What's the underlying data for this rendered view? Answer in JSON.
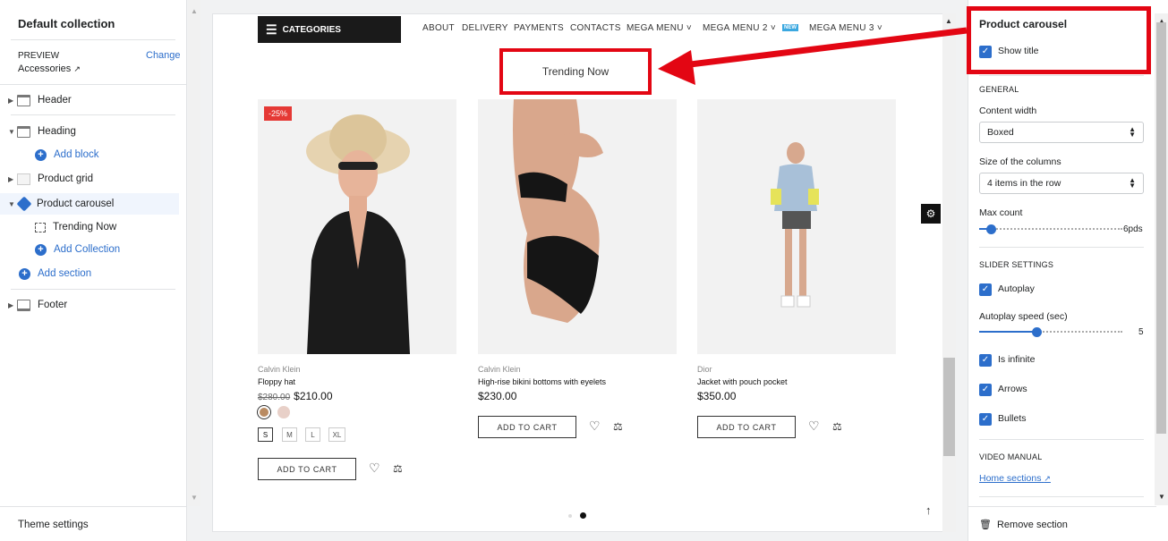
{
  "left": {
    "title": "Default collection",
    "preview_label": "PREVIEW",
    "change_label": "Change",
    "preview_value": "Accessories",
    "tree": [
      {
        "label": "Header",
        "icon": "header-layout-icon"
      },
      {
        "label": "Heading",
        "icon": "header-layout-icon"
      },
      {
        "label": "Add block",
        "icon": "add-icon"
      },
      {
        "label": "Product grid",
        "icon": "grid-icon"
      },
      {
        "label": "Product carousel",
        "icon": "tag-icon"
      },
      {
        "label": "Trending Now",
        "icon": "block-dashed-icon"
      },
      {
        "label": "Add Collection",
        "icon": "add-icon"
      },
      {
        "label": "Add section",
        "icon": "add-icon"
      },
      {
        "label": "Footer",
        "icon": "footer-layout-icon"
      }
    ],
    "theme_settings": "Theme settings"
  },
  "store": {
    "categories_label": "CATEGORIES",
    "nav": [
      "ABOUT",
      "DELIVERY",
      "PAYMENTS",
      "CONTACTS",
      "MEGA MENU ˅",
      "MEGA MENU 2 ˅",
      "MEGA MENU 3 ˅"
    ],
    "new_badge": "NEW",
    "section_title": "Trending Now",
    "products": [
      {
        "brand": "Calvin Klein",
        "name": "Floppy hat",
        "old_price": "$280.00",
        "price": "$210.00",
        "sale": "-25%",
        "sizes": [
          "S",
          "M",
          "L",
          "XL"
        ],
        "add_to_cart": "ADD TO CART"
      },
      {
        "brand": "Calvin Klein",
        "name": "High-rise bikini bottoms with eyelets",
        "price": "$230.00",
        "add_to_cart": "ADD TO CART"
      },
      {
        "brand": "Dior",
        "name": "Jacket with pouch pocket",
        "price": "$350.00",
        "add_to_cart": "ADD TO CART"
      }
    ]
  },
  "right": {
    "section_title": "Product carousel",
    "show_title_label": "Show title",
    "general_label": "GENERAL",
    "content_width_label": "Content width",
    "content_width_value": "Boxed",
    "columns_label": "Size of the columns",
    "columns_value": "4 items in the row",
    "max_count_label": "Max count",
    "max_count_value": "6pds",
    "max_count_fraction": 0.08,
    "slider_settings_label": "SLIDER SETTINGS",
    "autoplay_label": "Autoplay",
    "autoplay_speed_label": "Autoplay speed (sec)",
    "autoplay_speed_value": "5",
    "autoplay_speed_fraction": 0.4,
    "infinite_label": "Is infinite",
    "arrows_label": "Arrows",
    "bullets_label": "Bullets",
    "video_manual_label": "VIDEO MANUAL",
    "home_sections_link": "Home sections",
    "remove_section": "Remove section"
  },
  "colors": {
    "accent": "#2c6ecb",
    "annotation": "#e30613",
    "sale": "#e53935"
  }
}
